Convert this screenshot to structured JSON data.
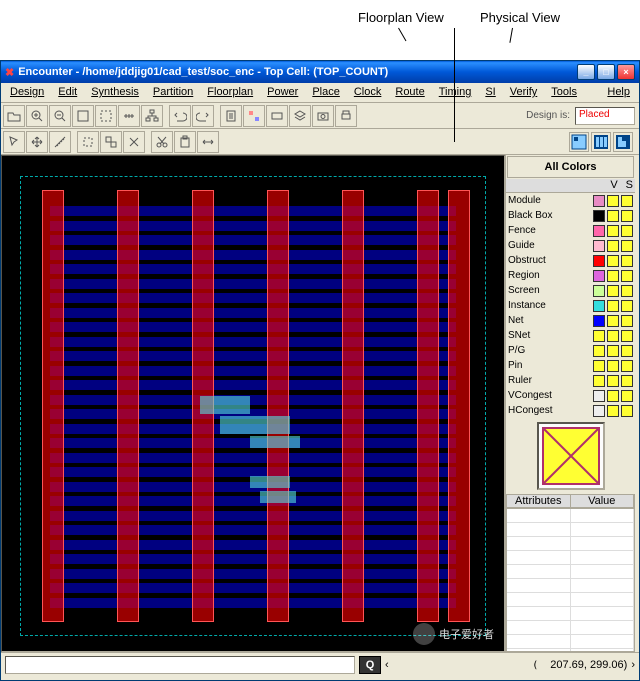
{
  "annotations": {
    "floorplan_view": "Floorplan View",
    "physical_view": "Physical View"
  },
  "titlebar": {
    "prefix": "Encounter - ",
    "path": "/home/jddjig01/cad_test/soc_enc",
    "suffix": " - Top Cell: (TOP_COUNT)"
  },
  "window_controls": {
    "min": "_",
    "max": "□",
    "close": "×"
  },
  "menu": [
    "Design",
    "Edit",
    "Synthesis",
    "Partition",
    "Floorplan",
    "Power",
    "Place",
    "Clock",
    "Route",
    "Timing",
    "SI",
    "Verify",
    "Tools",
    "Help"
  ],
  "toolbar1_icons": [
    "open",
    "zoom-in",
    "zoom-out",
    "zoom-fit",
    "zoom-sel",
    "ruler",
    "hier",
    "undo",
    "redo",
    "",
    "report",
    "highlight",
    "rect",
    "layers",
    "camera",
    "print"
  ],
  "design_label": "Design is:",
  "design_status": "Placed",
  "toolbar2_icons": [
    "select",
    "move",
    "measure",
    "",
    "box",
    "select-all",
    "hilite",
    "",
    "cut",
    "paste",
    "stretch"
  ],
  "view_buttons": [
    "floorplan-view",
    "physical-view",
    "amoeba-view"
  ],
  "side": {
    "all_colors": "All Colors",
    "hdr_v": "V",
    "hdr_s": "S",
    "layers": [
      {
        "n": "Module",
        "c1": "#e88bc4",
        "c2": "#ffff33"
      },
      {
        "n": "Black Box",
        "c1": "#000000",
        "c2": "#ffff33"
      },
      {
        "n": "Fence",
        "c1": "#ff66aa",
        "c2": "#ffff33"
      },
      {
        "n": "Guide",
        "c1": "#ffbbcf",
        "c2": "#ffff33"
      },
      {
        "n": "Obstruct",
        "c1": "#ff0000",
        "c2": "#ffff33"
      },
      {
        "n": "Region",
        "c1": "#dd66dd",
        "c2": "#ffff33"
      },
      {
        "n": "Screen",
        "c1": "#ccff99",
        "c2": "#ffff33"
      },
      {
        "n": "Instance",
        "c1": "#33dddd",
        "c2": "#ffff33"
      },
      {
        "n": "Net",
        "c1": "#0000ff",
        "c2": "#ffff33"
      },
      {
        "n": "SNet",
        "c1": "#ffff33",
        "c2": "#ffff33"
      },
      {
        "n": "P/G",
        "c1": "#ffff33",
        "c2": "#ffff33"
      },
      {
        "n": "Pin",
        "c1": "#ffff33",
        "c2": "#ffff33"
      },
      {
        "n": "Ruler",
        "c1": "#ffff33",
        "c2": "#ffff33"
      },
      {
        "n": "VCongest",
        "c1": "#eeeeee",
        "c2": "#ffff33"
      },
      {
        "n": "HCongest",
        "c1": "#eeeeee",
        "c2": "#ffff33"
      }
    ],
    "attr_hdr_a": "Attributes",
    "attr_hdr_v": "Value"
  },
  "statusbar": {
    "q": "Q",
    "nav_l": "‹",
    "nav_r": "›",
    "coord": "207.69,   299.06)"
  },
  "watermark": {
    "text": "电子爱好者"
  }
}
